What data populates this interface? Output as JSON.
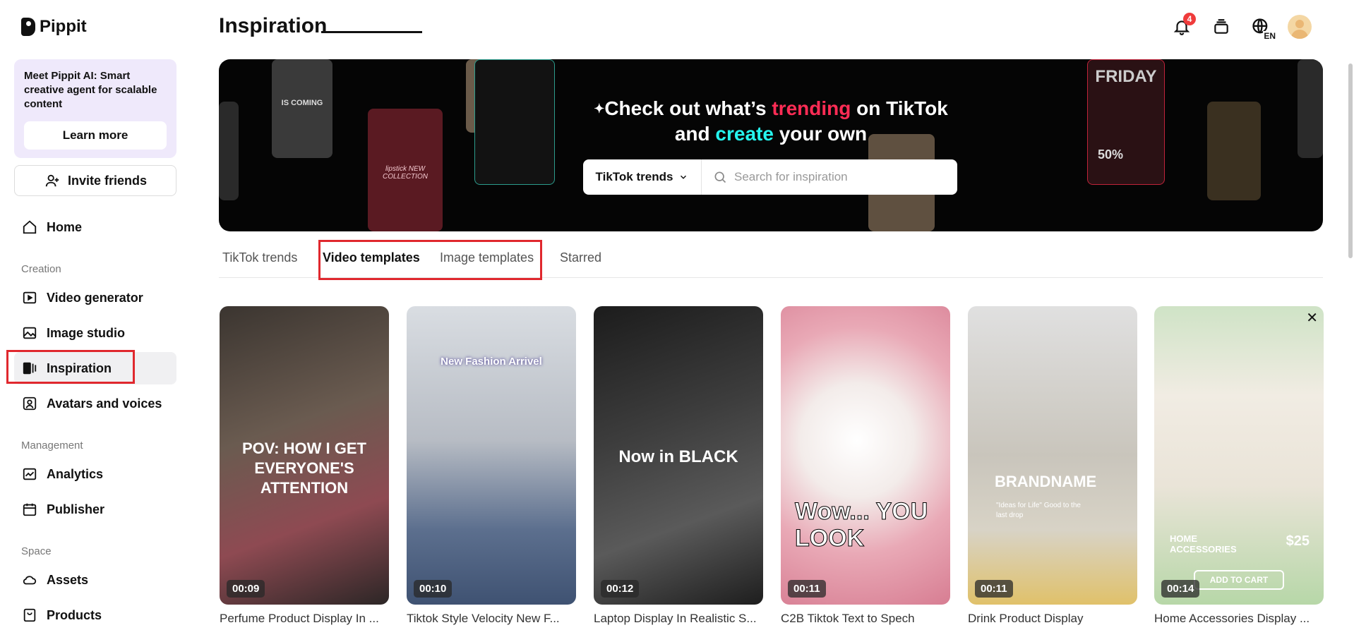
{
  "brand": {
    "name": "Pippit"
  },
  "promo": {
    "text": "Meet Pippit AI: Smart creative agent for scalable content",
    "button": "Learn more"
  },
  "invite": {
    "label": "Invite friends"
  },
  "nav": {
    "home": "Home",
    "creation_label": "Creation",
    "video_generator": "Video generator",
    "image_studio": "Image studio",
    "inspiration": "Inspiration",
    "avatars_voices": "Avatars and voices",
    "management_label": "Management",
    "analytics": "Analytics",
    "publisher": "Publisher",
    "space_label": "Space",
    "assets": "Assets",
    "products": "Products"
  },
  "header": {
    "title": "Inspiration",
    "notification_count": "4",
    "language": "EN"
  },
  "banner": {
    "title_part1": "Check out what’s ",
    "title_trending": "trending",
    "title_part2": " on TikTok",
    "title_part3": "and ",
    "title_create": "create",
    "title_part4": " your own",
    "select_label": "TikTok trends",
    "search_placeholder": "Search for inspiration",
    "deco_text": {
      "coming": "IS COMING",
      "lipstick": "lipstick NEW COLLECTION",
      "friday": "FRIDAY",
      "percent": "50%"
    }
  },
  "tabs": [
    "TikTok trends",
    "Video templates",
    "Image templates",
    "Starred"
  ],
  "cards": [
    {
      "title": "Perfume Product Display In ...",
      "duration": "00:09",
      "overlay": "POV: HOW I GET EVERYONE'S ATTENTION"
    },
    {
      "title": "Tiktok Style Velocity New F...",
      "duration": "00:10",
      "overlay": "New Fashion Arrivel"
    },
    {
      "title": "Laptop Display In Realistic S...",
      "duration": "00:12",
      "overlay": "Now in BLACK"
    },
    {
      "title": "C2B Tiktok Text to Spech",
      "duration": "00:11",
      "overlay": "Wow... YOU LOOK"
    },
    {
      "title": "Drink Product Display",
      "duration": "00:11",
      "overlay": "BRANDNAME",
      "sub": "\"Ideas for Life\" Good to the last drop"
    },
    {
      "title": "Home Accessories Display ...",
      "duration": "00:14",
      "overlay": "HOME ACCESSORIES",
      "price": "$25",
      "cta": "ADD TO CART"
    }
  ],
  "colors": {
    "accent_red": "#e0282e",
    "tiktok_pink": "#fe2c55",
    "tiktok_cyan": "#25f4ee"
  }
}
